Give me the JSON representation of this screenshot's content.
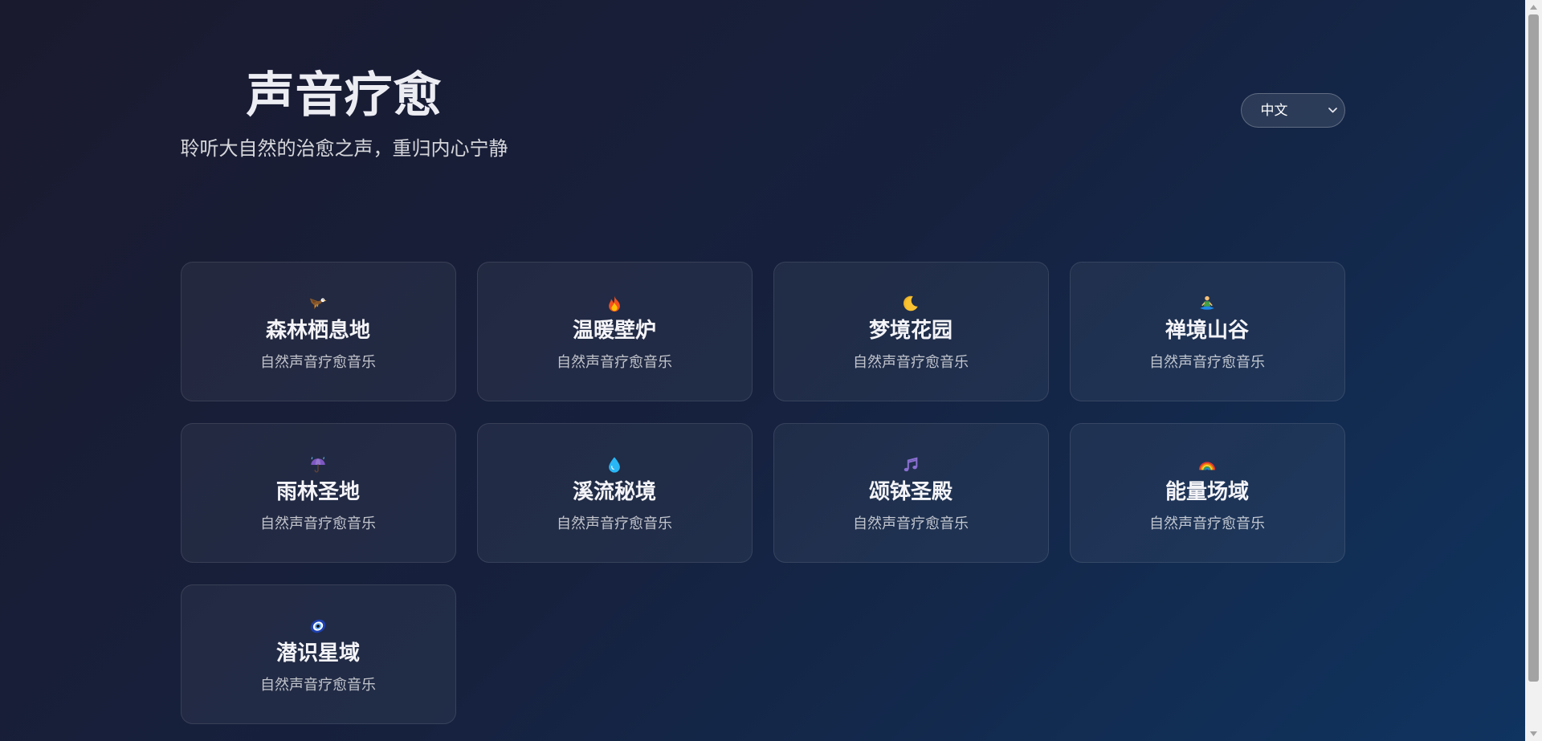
{
  "header": {
    "title": "声音疗愈",
    "subtitle": "聆听大自然的治愈之声，重归内心宁静"
  },
  "language_select": {
    "selected": "中文",
    "icon": "chevron-down-icon"
  },
  "cards": [
    {
      "icon": "eagle-icon",
      "title": "森林栖息地",
      "subtitle": "自然声音疗愈音乐"
    },
    {
      "icon": "fire-icon",
      "title": "温暖壁炉",
      "subtitle": "自然声音疗愈音乐"
    },
    {
      "icon": "moon-icon",
      "title": "梦境花园",
      "subtitle": "自然声音疗愈音乐"
    },
    {
      "icon": "meditation-icon",
      "title": "禅境山谷",
      "subtitle": "自然声音疗愈音乐"
    },
    {
      "icon": "umbrella-icon",
      "title": "雨林圣地",
      "subtitle": "自然声音疗愈音乐"
    },
    {
      "icon": "droplet-icon",
      "title": "溪流秘境",
      "subtitle": "自然声音疗愈音乐"
    },
    {
      "icon": "music-note-icon",
      "title": "颂钵圣殿",
      "subtitle": "自然声音疗愈音乐"
    },
    {
      "icon": "rainbow-icon",
      "title": "能量场域",
      "subtitle": "自然声音疗愈音乐"
    },
    {
      "icon": "nazar-amulet-icon",
      "title": "潜识星域",
      "subtitle": "自然声音疗愈音乐"
    }
  ],
  "theme": {
    "background_gradient": [
      "#1a1a2e",
      "#16213e",
      "#0f3460"
    ],
    "title_color": "#ececf3",
    "scrollbar_track": "#f1f1f1",
    "scrollbar_thumb": "#a3a3a3"
  }
}
